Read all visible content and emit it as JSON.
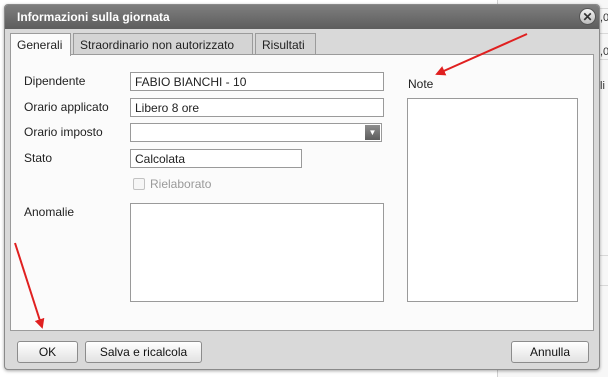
{
  "dialog": {
    "title": "Informazioni sulla giornata"
  },
  "tabs": [
    {
      "label": "Generali",
      "active": true
    },
    {
      "label": "Straordinario non autorizzato",
      "active": false
    },
    {
      "label": "Risultati",
      "active": false
    }
  ],
  "form": {
    "dipendente_label": "Dipendente",
    "dipendente_value": "FABIO BIANCHI - 10",
    "orario_applicato_label": "Orario applicato",
    "orario_applicato_value": "Libero 8 ore",
    "orario_imposto_label": "Orario imposto",
    "orario_imposto_value": "",
    "stato_label": "Stato",
    "stato_value": "Calcolata",
    "rielaborato_label": "Rielaborato",
    "rielaborato_checked": false,
    "anomalie_label": "Anomalie",
    "note_label": "Note"
  },
  "buttons": {
    "ok": "OK",
    "salva": "Salva e ricalcola",
    "annulla": "Annulla"
  },
  "background": {
    "fragment_1": ",0",
    "fragment_2": ",0",
    "fragment_3": "li"
  },
  "colors": {
    "annotation_arrow": "#e02020",
    "titlebar": "#6e6e6e"
  }
}
